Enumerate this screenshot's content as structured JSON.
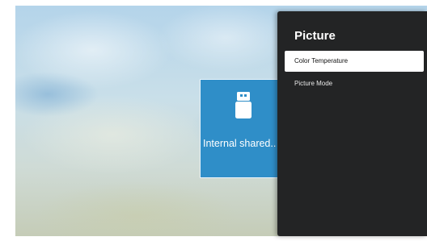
{
  "background": {
    "colors": {
      "sky": "#b4d4ea",
      "land": "#c5ccb7"
    }
  },
  "storage_card": {
    "icon": "usb-drive-icon",
    "label": "Internal shared..",
    "color": "#2f8ec8"
  },
  "settings_panel": {
    "title": "Picture",
    "background_color": "#232425",
    "items": [
      {
        "label": "Color Temperature",
        "selected": true
      },
      {
        "label": "Picture Mode",
        "selected": false
      }
    ]
  }
}
